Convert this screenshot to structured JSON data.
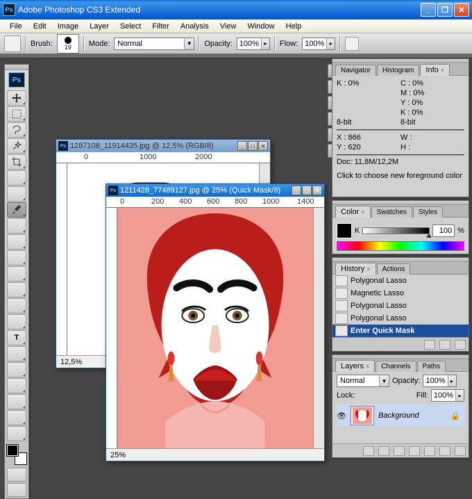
{
  "app": {
    "title": "Adobe Photoshop CS3 Extended",
    "icon": "Ps"
  },
  "menu": [
    "File",
    "Edit",
    "Image",
    "Layer",
    "Select",
    "Filter",
    "Analysis",
    "View",
    "Window",
    "Help"
  ],
  "opt": {
    "brush": "Brush:",
    "brushSize": "19",
    "mode": "Mode:",
    "modeVal": "Normal",
    "opacity": "Opacity:",
    "opacityVal": "100%",
    "flow": "Flow:",
    "flowVal": "100%"
  },
  "doc1": {
    "title": "1287108_11914435.jpg @ 12,5% (RGB/8)",
    "zoom": "12,5%"
  },
  "doc2": {
    "title": "1211428_77489127.jpg @ 25% (Quick Mask/8)",
    "zoom": "25%"
  },
  "nav": {
    "t1": "Navigator",
    "t2": "Histogram",
    "t3": "Info",
    "k": "K :",
    "kp": "0%",
    "c": "C :",
    "m": "M :",
    "y": "Y :",
    "k2": "K :",
    "p": "0%",
    "bit": "8-bit",
    "x": "X :",
    "xval": "866",
    "yv": "Y :",
    "yval": "620",
    "w": "W :",
    "h": "H :",
    "doc": "Doc: 11,8M/12,2M",
    "hint": "Click to choose new foreground color"
  },
  "color": {
    "t1": "Color",
    "t2": "Swatches",
    "t3": "Styles",
    "klab": "K",
    "kval": "100",
    "pct": "%"
  },
  "hist": {
    "t1": "History",
    "t2": "Actions",
    "r": [
      "Polygonal Lasso",
      "Magnetic Lasso",
      "Polygonal Lasso",
      "Polygonal Lasso",
      "Enter Quick Mask"
    ]
  },
  "layers": {
    "t1": "Layers",
    "t2": "Channels",
    "t3": "Paths",
    "mode": "Normal",
    "op": "Opacity:",
    "opv": "100%",
    "lock": "Lock:",
    "fill": "Fill:",
    "fillv": "100%",
    "bg": "Background"
  }
}
